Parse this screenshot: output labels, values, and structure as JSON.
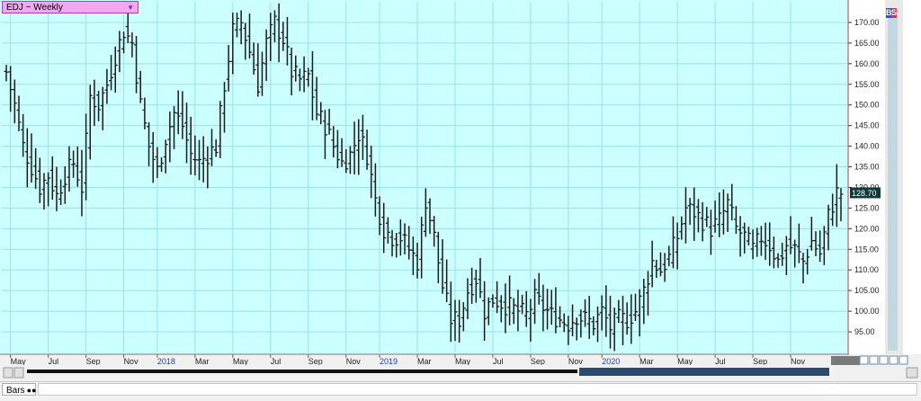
{
  "header": {
    "symbol_label": "EDJ ~ Weekly",
    "dropdown_icon": "triangle-down-icon"
  },
  "indicators": {
    "buy": "B",
    "sell": "S"
  },
  "status": {
    "tab_label": "Bars",
    "tab_icon": "glasses-icon"
  },
  "colors": {
    "background": "#ccffff",
    "grid": "#9be0e8",
    "bars": "#1a1a1a",
    "last_price_bg": "#0f3a3a",
    "year_label": "#2040c0",
    "axis": "#d04040"
  },
  "chart_data": {
    "type": "bar",
    "subtype": "ohlc-weekly",
    "title": "EDJ ~ Weekly",
    "ylim": [
      90,
      175
    ],
    "grid": true,
    "y_ticks": [
      "95.00",
      "100.00",
      "105.00",
      "110.00",
      "115.00",
      "120.00",
      "125.00",
      "130.00",
      "135.00",
      "140.00",
      "145.00",
      "150.00",
      "155.00",
      "160.00",
      "165.00",
      "170.00"
    ],
    "x_labels": [
      {
        "text": "May",
        "week": 1,
        "year": false
      },
      {
        "text": "Jul",
        "week": 10,
        "year": false
      },
      {
        "text": "Sep",
        "week": 19,
        "year": false
      },
      {
        "text": "Nov",
        "week": 28,
        "year": false
      },
      {
        "text": "2018",
        "week": 36,
        "year": true
      },
      {
        "text": "Mar",
        "week": 45,
        "year": false
      },
      {
        "text": "May",
        "week": 54,
        "year": false
      },
      {
        "text": "Jul",
        "week": 63,
        "year": false
      },
      {
        "text": "Sep",
        "week": 72,
        "year": false
      },
      {
        "text": "Nov",
        "week": 81,
        "year": false
      },
      {
        "text": "2019",
        "week": 89,
        "year": true
      },
      {
        "text": "Mar",
        "week": 98,
        "year": false
      },
      {
        "text": "May",
        "week": 107,
        "year": false
      },
      {
        "text": "Jul",
        "week": 116,
        "year": false
      },
      {
        "text": "Sep",
        "week": 125,
        "year": false
      },
      {
        "text": "Nov",
        "week": 134,
        "year": false
      },
      {
        "text": "2020",
        "week": 142,
        "year": true
      },
      {
        "text": "Mar",
        "week": 151,
        "year": false
      },
      {
        "text": "May",
        "week": 160,
        "year": false
      },
      {
        "text": "Jul",
        "week": 169,
        "year": false
      },
      {
        "text": "Sep",
        "week": 178,
        "year": false
      },
      {
        "text": "Nov",
        "week": 187,
        "year": false
      }
    ],
    "last_price": "128.70",
    "last_value": 128.7,
    "key_closes": [
      [
        0,
        158
      ],
      [
        2,
        150
      ],
      [
        4,
        140
      ],
      [
        6,
        135
      ],
      [
        8,
        130
      ],
      [
        10,
        133
      ],
      [
        12,
        128
      ],
      [
        14,
        133
      ],
      [
        16,
        136
      ],
      [
        18,
        130
      ],
      [
        20,
        152
      ],
      [
        22,
        150
      ],
      [
        24,
        155
      ],
      [
        26,
        162
      ],
      [
        28,
        168
      ],
      [
        30,
        165
      ],
      [
        32,
        150
      ],
      [
        34,
        140
      ],
      [
        36,
        134
      ],
      [
        38,
        142
      ],
      [
        40,
        148
      ],
      [
        42,
        145
      ],
      [
        44,
        138
      ],
      [
        46,
        136
      ],
      [
        48,
        138
      ],
      [
        50,
        140
      ],
      [
        52,
        155
      ],
      [
        54,
        168
      ],
      [
        56,
        170
      ],
      [
        58,
        163
      ],
      [
        60,
        155
      ],
      [
        62,
        165
      ],
      [
        64,
        170
      ],
      [
        66,
        166
      ],
      [
        68,
        158
      ],
      [
        70,
        156
      ],
      [
        72,
        157
      ],
      [
        74,
        148
      ],
      [
        76,
        145
      ],
      [
        78,
        140
      ],
      [
        80,
        136
      ],
      [
        82,
        138
      ],
      [
        84,
        143
      ],
      [
        86,
        138
      ],
      [
        88,
        127
      ],
      [
        90,
        120
      ],
      [
        92,
        118
      ],
      [
        94,
        118
      ],
      [
        96,
        115
      ],
      [
        98,
        112
      ],
      [
        100,
        127
      ],
      [
        102,
        118
      ],
      [
        104,
        106
      ],
      [
        106,
        98
      ],
      [
        108,
        98
      ],
      [
        110,
        105
      ],
      [
        112,
        108
      ],
      [
        114,
        100
      ],
      [
        116,
        103
      ],
      [
        118,
        102
      ],
      [
        120,
        101
      ],
      [
        122,
        100
      ],
      [
        124,
        99
      ],
      [
        126,
        103
      ],
      [
        128,
        101
      ],
      [
        130,
        99
      ],
      [
        132,
        98
      ],
      [
        134,
        97
      ],
      [
        136,
        99
      ],
      [
        138,
        98
      ],
      [
        140,
        97
      ],
      [
        142,
        100
      ],
      [
        144,
        96
      ],
      [
        146,
        98
      ],
      [
        148,
        98
      ],
      [
        150,
        100
      ],
      [
        152,
        105
      ],
      [
        154,
        112
      ],
      [
        156,
        110
      ],
      [
        158,
        113
      ],
      [
        160,
        118
      ],
      [
        162,
        125
      ],
      [
        164,
        124
      ],
      [
        166,
        122
      ],
      [
        168,
        120
      ],
      [
        170,
        122
      ],
      [
        172,
        126
      ],
      [
        174,
        120
      ],
      [
        176,
        118
      ],
      [
        178,
        115
      ],
      [
        180,
        118
      ],
      [
        182,
        116
      ],
      [
        184,
        112
      ],
      [
        186,
        116
      ],
      [
        188,
        115
      ],
      [
        190,
        112
      ],
      [
        192,
        117
      ],
      [
        194,
        114
      ],
      [
        196,
        123
      ],
      [
        198,
        128.7
      ]
    ]
  }
}
